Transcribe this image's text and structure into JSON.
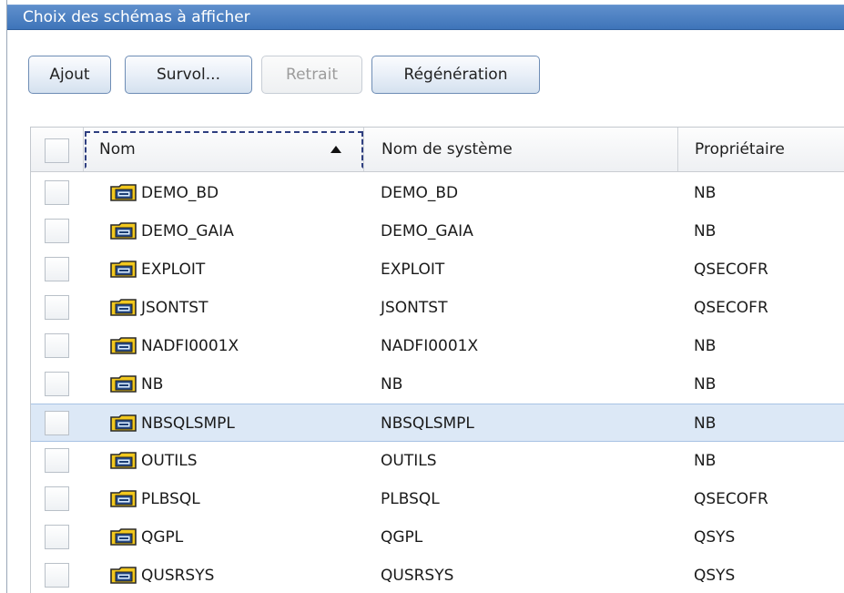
{
  "window": {
    "title": "Choix des schémas à afficher"
  },
  "toolbar": {
    "buttons": [
      {
        "label": "Ajout",
        "enabled": true
      },
      {
        "label": "Survol...",
        "enabled": true
      },
      {
        "label": "Retrait",
        "enabled": false
      },
      {
        "label": "Régénération",
        "enabled": true
      }
    ]
  },
  "table": {
    "columns": [
      "Nom",
      "Nom de système",
      "Propriétaire"
    ],
    "sort": {
      "column": "Nom",
      "direction": "ascending"
    },
    "selected_row": "NBSQLSMPL",
    "rows": [
      {
        "nom": "DEMO_BD",
        "systeme": "DEMO_BD",
        "proprietaire": "NB"
      },
      {
        "nom": "DEMO_GAIA",
        "systeme": "DEMO_GAIA",
        "proprietaire": "NB"
      },
      {
        "nom": "EXPLOIT",
        "systeme": "EXPLOIT",
        "proprietaire": "QSECOFR"
      },
      {
        "nom": "JSONTST",
        "systeme": "JSONTST",
        "proprietaire": "QSECOFR"
      },
      {
        "nom": "NADFI0001X",
        "systeme": "NADFI0001X",
        "proprietaire": "NB"
      },
      {
        "nom": "NB",
        "systeme": "NB",
        "proprietaire": "NB"
      },
      {
        "nom": "NBSQLSMPL",
        "systeme": "NBSQLSMPL",
        "proprietaire": "NB"
      },
      {
        "nom": "OUTILS",
        "systeme": "OUTILS",
        "proprietaire": "NB"
      },
      {
        "nom": "PLBSQL",
        "systeme": "PLBSQL",
        "proprietaire": "QSECOFR"
      },
      {
        "nom": "QGPL",
        "systeme": "QGPL",
        "proprietaire": "QSYS"
      },
      {
        "nom": "QUSRSYS",
        "systeme": "QUSRSYS",
        "proprietaire": "QSYS"
      }
    ]
  },
  "icons": {
    "row_icon": "schema-folder-icon",
    "sort_icon": "sort-ascending-icon"
  },
  "colors": {
    "title_bar": "#3e74b9",
    "selected_row": "#dce8f6",
    "folder": "#f2c81e"
  }
}
